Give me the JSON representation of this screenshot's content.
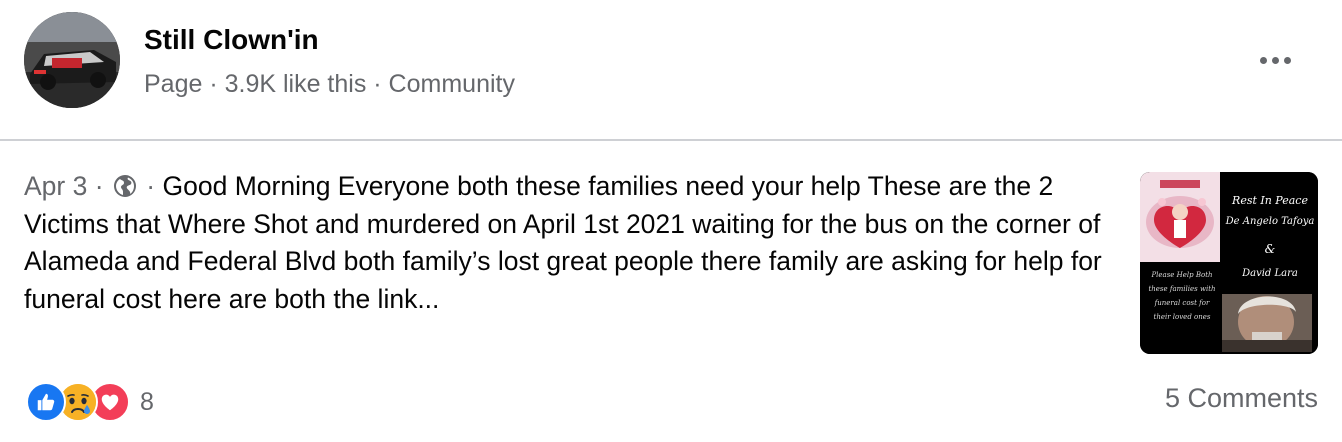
{
  "page": {
    "name": "Still Clown'in",
    "meta": "Page · 3.9K like this · Community"
  },
  "post": {
    "date": "Apr 3",
    "separator": "·",
    "privacy_icon": "globe-icon",
    "text": "Good Morning Everyone both these families need your help These are the 2 Victims that Where Shot and murdered on April 1st 2021 waiting for the bus on the corner of Alameda and Federal Blvd both family’s lost great people there family are asking for help for funeral cost here are both the link..."
  },
  "thumbnail": {
    "heading": "Rest In Peace",
    "name_1": "De Angelo Tafoya",
    "ampersand": "&",
    "name_2": "David Lara",
    "small_text": "Please Help Both these families with funeral cost for their loved ones"
  },
  "footer": {
    "reaction_icons": [
      "like-icon",
      "sad-icon",
      "love-icon"
    ],
    "reaction_count": "8",
    "comments": "5 Comments"
  },
  "colors": {
    "like": "#1877f2",
    "sad": "#f7b125",
    "love": "#f33e58",
    "secondary_text": "#65676b",
    "divider": "#ced0d4"
  }
}
